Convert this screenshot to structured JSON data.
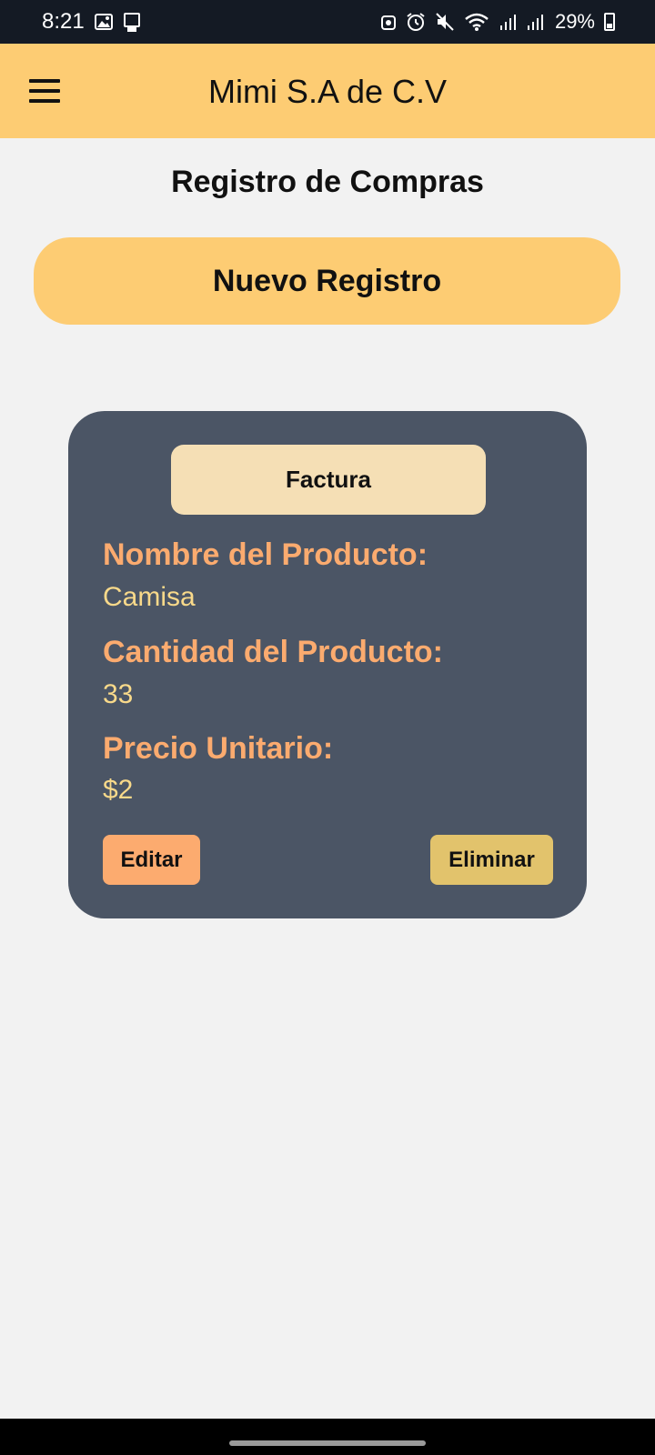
{
  "status_bar": {
    "time": "8:21",
    "battery": "29%",
    "icons": [
      "image-icon",
      "device-icon",
      "android-icon",
      "alarm-icon",
      "mute-icon",
      "wifi-icon",
      "signal-icon",
      "signal-icon",
      "battery-icon"
    ]
  },
  "app_bar": {
    "title": "Mimi S.A de C.V",
    "menu_icon": "menu-icon"
  },
  "main": {
    "title": "Registro de Compras",
    "new_button": "Nuevo Registro"
  },
  "card": {
    "invoice_button": "Factura",
    "product_name_label": "Nombre del Producto:",
    "product_name_value": "Camisa",
    "quantity_label": "Cantidad del Producto:",
    "quantity_value": "33",
    "price_label": "Precio Unitario:",
    "price_value": "$2",
    "edit_button": "Editar",
    "delete_button": "Eliminar"
  },
  "colors": {
    "accent": "#fdcc73",
    "card_bg": "#4b5565",
    "label": "#fbab6f",
    "value": "#f8d98a",
    "edit": "#fcab6f",
    "delete": "#e2c36c",
    "invoice": "#f5dfb5"
  }
}
